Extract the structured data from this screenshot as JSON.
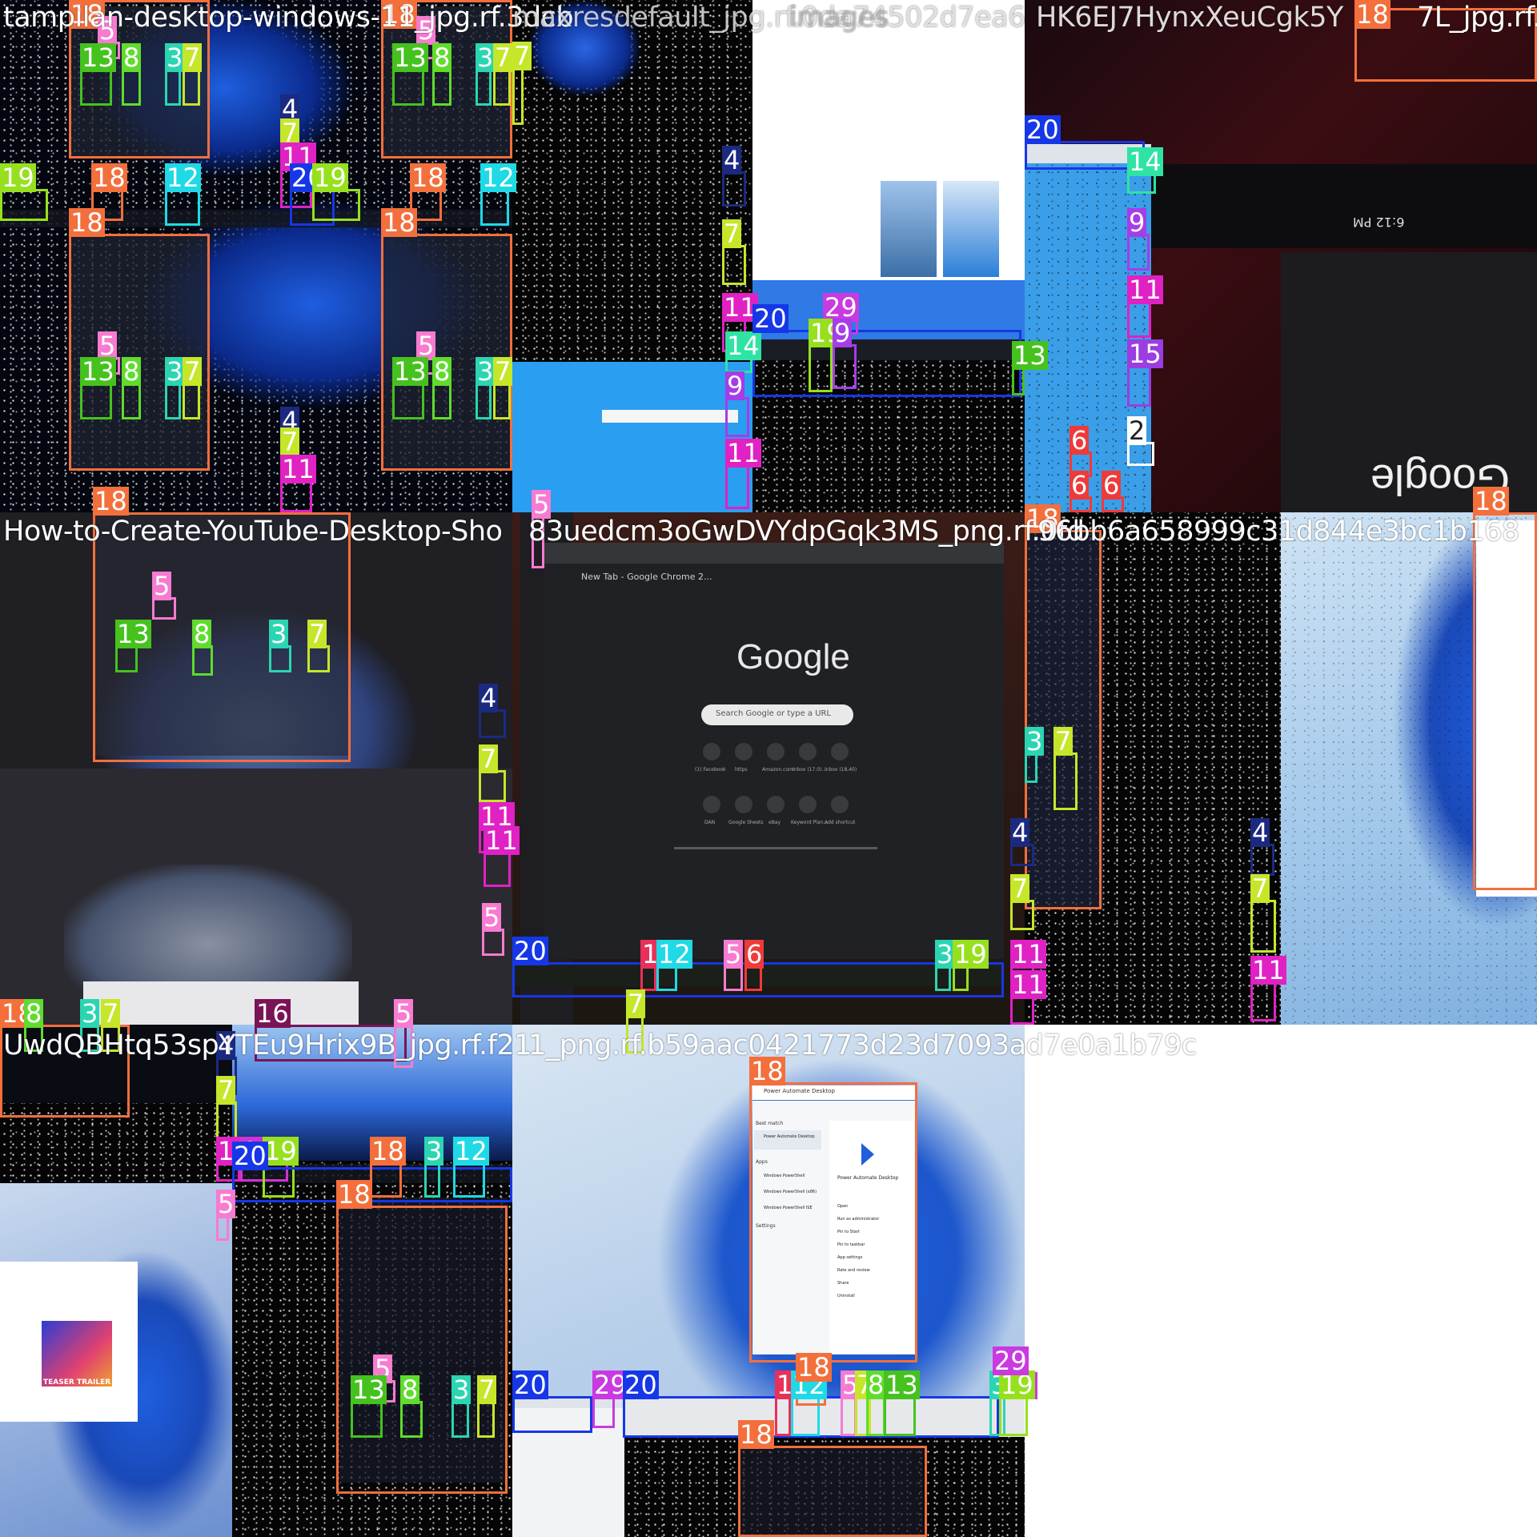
{
  "tiles": [
    {
      "caption": "tampilan-desktop-windows-11_jpg.rf.3dcb"
    },
    {
      "caption": "maxresdefault_jpg.rf.0da74502d7ea6"
    },
    {
      "caption": "HK6EJ7HynxXeuCgk5Y"
    },
    {
      "caption": "How-to-Create-YouTube-Desktop-Sho"
    },
    {
      "caption": "83uedcm3oGwDVYdpGqk3MS_png.rf.0fd"
    },
    {
      "caption": "96bb6a658999c31d844e3bc1b168"
    },
    {
      "caption": "UwdQBHtq53spYTEu9Hrix9B_jpg.rf.f21"
    },
    {
      "caption": "images"
    },
    {
      "caption": "1_png.rf.b59aac0421773d23d7093ad7e0a1b79c"
    },
    {
      "caption": "7L_jpg.rf.0"
    }
  ],
  "google": {
    "logo": "Google",
    "search_placeholder": "Search Google or type a URL",
    "tab_title": "New Tab - Google Chrome 2...",
    "shortcuts": [
      "(1) Facebook",
      "https",
      "Amazon.com",
      "Inbox (17.0)...",
      "Inbox (18,40)",
      "DAN",
      "Google Sheets",
      "eBay",
      "Keyword Plan...",
      "Add shortcut"
    ]
  },
  "start_menu": {
    "search_text": "Power Automate Desktop",
    "best_match": "Best match",
    "app_title": "Power Automate Desktop",
    "apps_header": "Apps",
    "apps": [
      "Windows PowerShell",
      "Windows PowerShell (x86)",
      "Windows PowerShell ISE"
    ],
    "settings_header": "Settings",
    "actions": [
      "Open",
      "Run as administrator",
      "Pin to Start",
      "Pin to taskbar",
      "App settings",
      "Rate and review",
      "Share",
      "Uninstall"
    ]
  },
  "chrome_dark": {
    "clock": "6:12 PM",
    "logo": "Google"
  },
  "teaser": {
    "line1": "TEASER TRAILER"
  },
  "boxes": [
    {
      "label": "18",
      "color": "#f36f3c"
    },
    {
      "label": "5",
      "color": "#f77bd0"
    },
    {
      "label": "13",
      "color": "#46c21f"
    },
    {
      "label": "8",
      "color": "#5fdc2c"
    },
    {
      "label": "3",
      "color": "#2bd5b2"
    },
    {
      "label": "7",
      "color": "#c6e62a"
    },
    {
      "label": "4",
      "color": "#1b2a80"
    },
    {
      "label": "11",
      "color": "#e021c4"
    },
    {
      "label": "19",
      "color": "#97e01e"
    },
    {
      "label": "12",
      "color": "#1fd9e6"
    },
    {
      "label": "20",
      "color": "#1637e8"
    },
    {
      "label": "14",
      "color": "#2ee3a3"
    },
    {
      "label": "9",
      "color": "#a53de8"
    },
    {
      "label": "15",
      "color": "#9b3de0"
    },
    {
      "label": "6",
      "color": "#ef3a3a"
    },
    {
      "label": "2",
      "color": "#ffffff"
    },
    {
      "label": "1",
      "color": "#e8305a"
    },
    {
      "label": "16",
      "color": "#7a1456"
    },
    {
      "label": "29",
      "color": "#c93ae0"
    },
    {
      "label": "10",
      "color": "#d132d6"
    }
  ]
}
